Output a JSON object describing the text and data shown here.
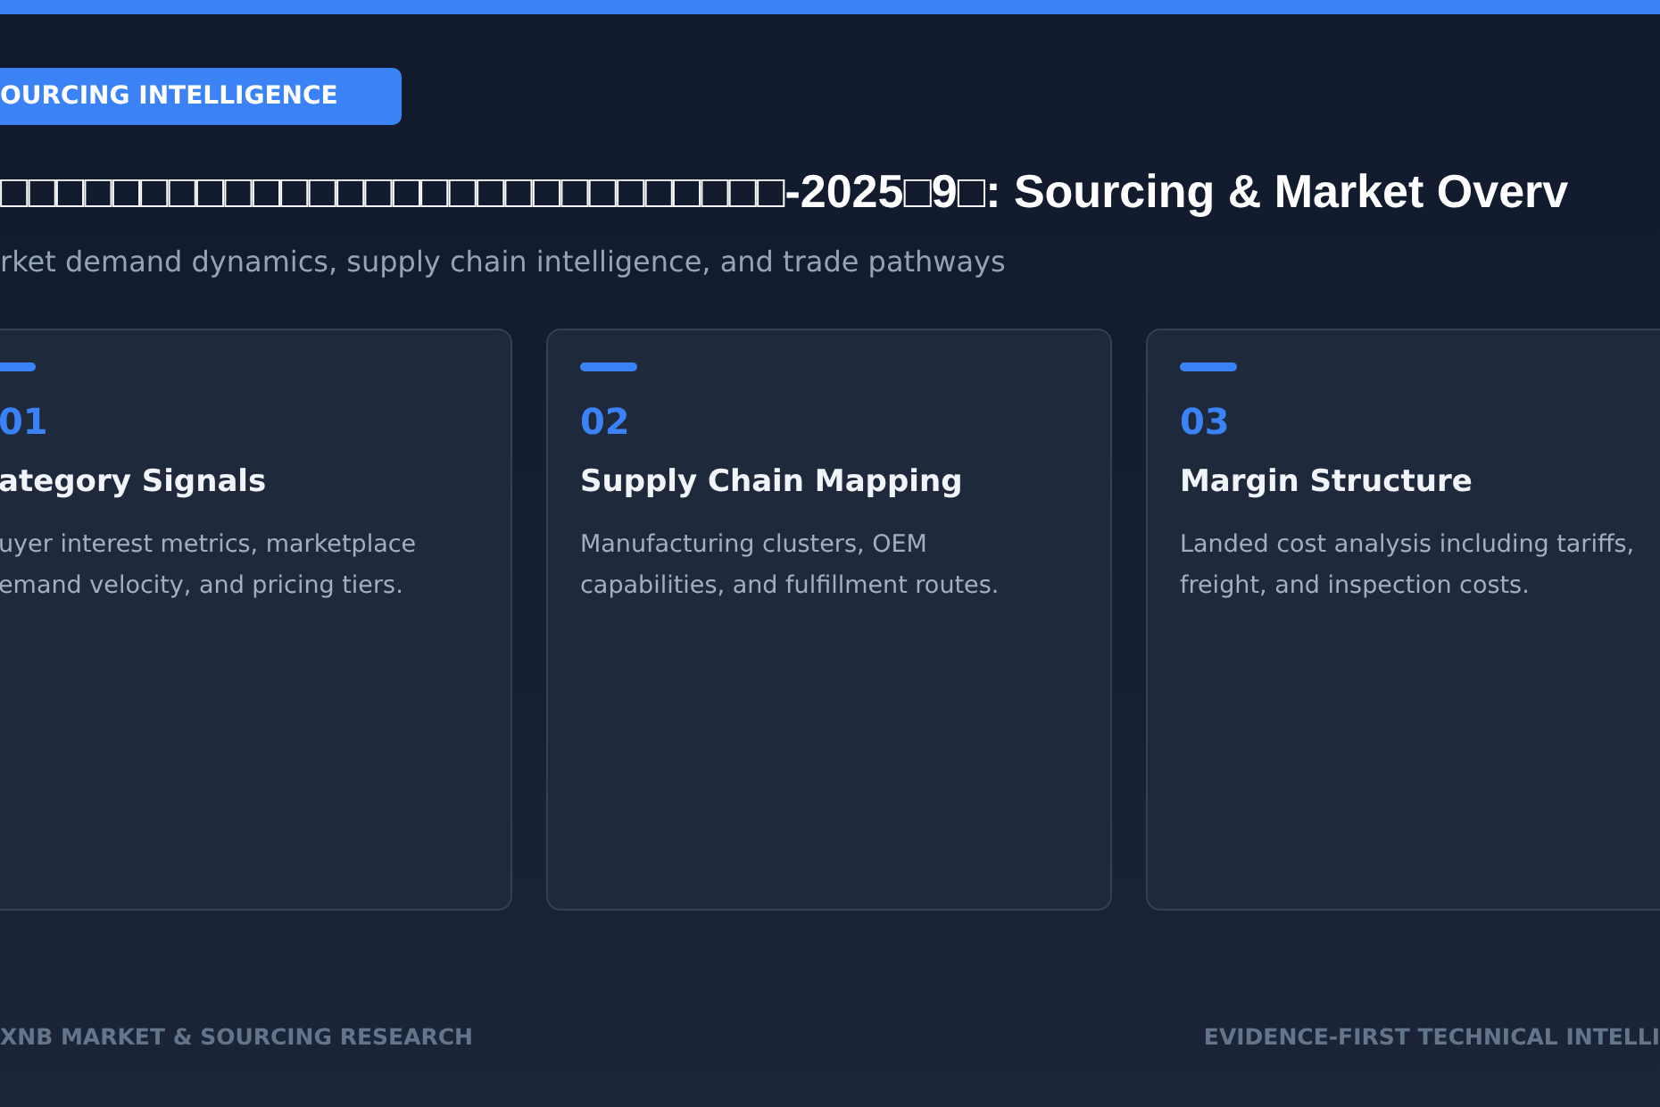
{
  "badge": "OURCING INTELLIGENCE",
  "title": "□□□□□□□□□□□□□□□□□□□□□□□□□□□□-2025□9□: Sourcing & Market Overv",
  "subtitle": "rket demand dynamics, supply chain intelligence, and trade pathways",
  "cards": [
    {
      "number": "01",
      "title": "ategory Signals",
      "lines": [
        "uyer interest metrics, marketplace",
        "emand velocity, and pricing tiers."
      ]
    },
    {
      "number": "02",
      "title": "Supply Chain Mapping",
      "lines": [
        "Manufacturing clusters, OEM",
        "capabilities, and fulfillment routes."
      ]
    },
    {
      "number": "03",
      "title": "Margin Structure",
      "lines": [
        "Landed cost analysis including tariffs,",
        "freight, and inspection costs."
      ]
    }
  ],
  "footer": {
    "left": "XNB MARKET & SOURCING RESEARCH",
    "right": "EVIDENCE-FIRST TECHNICAL INTELLI"
  }
}
